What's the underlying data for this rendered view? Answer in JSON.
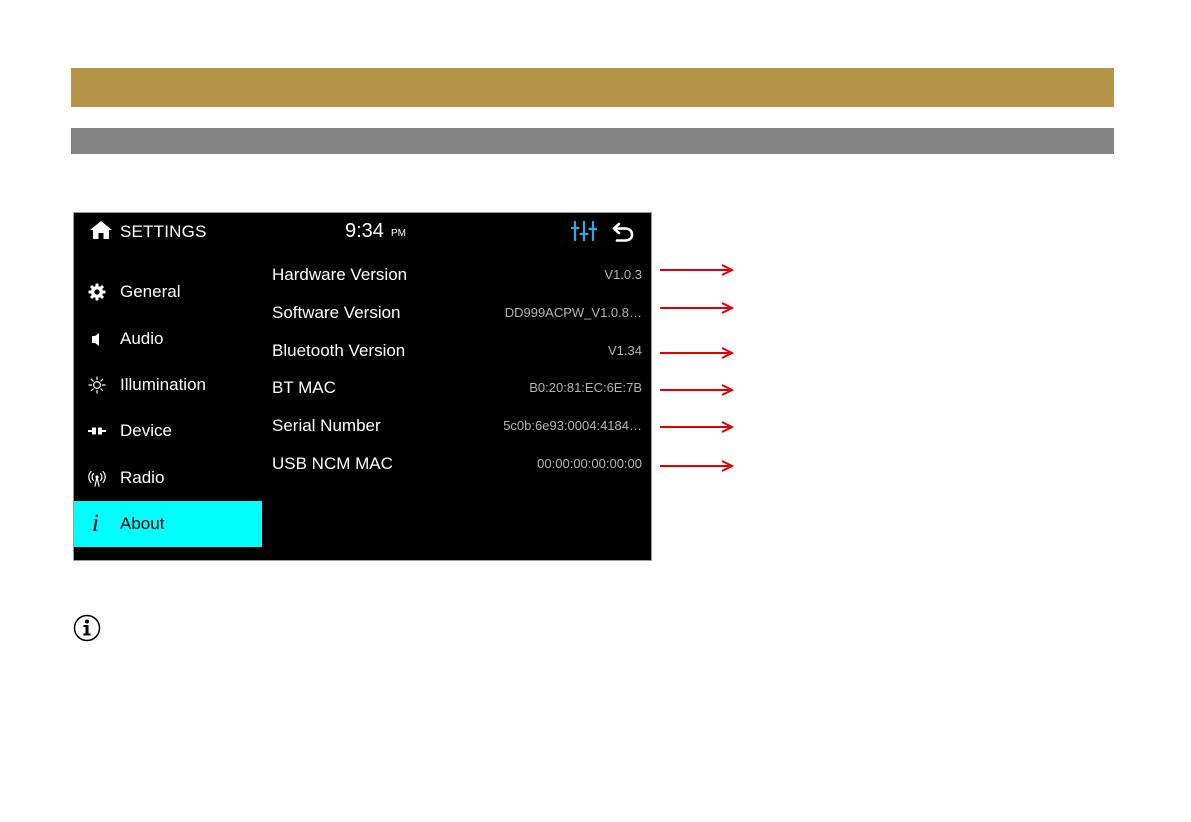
{
  "header": {
    "title": "SETTINGS",
    "time": "9:34",
    "ampm": "PM"
  },
  "sidebar": {
    "items": [
      {
        "label": "General",
        "icon": "gear-icon"
      },
      {
        "label": "Audio",
        "icon": "speaker-icon"
      },
      {
        "label": "Illumination",
        "icon": "sun-icon"
      },
      {
        "label": "Device",
        "icon": "plug-icon"
      },
      {
        "label": "Radio",
        "icon": "antenna-icon"
      },
      {
        "label": "About",
        "icon": "info-icon",
        "active": true
      }
    ]
  },
  "about": {
    "rows": [
      {
        "label": "Hardware Version",
        "value": "V1.0.3"
      },
      {
        "label": "Software Version",
        "value": "DD999ACPW_V1.0.8…"
      },
      {
        "label": "Bluetooth Version",
        "value": "V1.34"
      },
      {
        "label": "BT MAC",
        "value": "B0:20:81:EC:6E:7B"
      },
      {
        "label": "Serial Number",
        "value": "5c0b:6e93:0004:4184…"
      },
      {
        "label": "USB NCM MAC",
        "value": "00:00:00:00:00:00"
      }
    ]
  },
  "colors": {
    "gold_bar": "#b69447",
    "gray_bar": "#848484",
    "active_item": "#00ffff",
    "accent_icon": "#2fa8e6",
    "arrow": "#e00000"
  }
}
